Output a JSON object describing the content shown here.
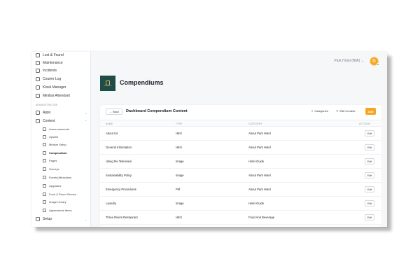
{
  "sidebar": {
    "items_top": [
      {
        "label": "Lost & Found",
        "icon": "lost-found-icon"
      },
      {
        "label": "Maintenance",
        "icon": "maintenance-icon"
      },
      {
        "label": "Incidents",
        "icon": "incidents-icon"
      },
      {
        "label": "Courier Log",
        "icon": "courier-log-icon"
      },
      {
        "label": "Kiosk Manager",
        "icon": "kiosk-icon"
      },
      {
        "label": "Minibar Attendant",
        "icon": "minibar-icon"
      }
    ],
    "section_label": "ADMINISTRATION",
    "apps": {
      "label": "Apps"
    },
    "content": {
      "label": "Content"
    },
    "content_items": [
      {
        "label": "Announcements"
      },
      {
        "label": "Upsells"
      },
      {
        "label": "Minibar Setup"
      },
      {
        "label": "Compendium"
      },
      {
        "label": "Pages"
      },
      {
        "label": "Surveys"
      },
      {
        "label": "Events/Attractions"
      },
      {
        "label": "Upgrades"
      },
      {
        "label": "Food & Room Service"
      },
      {
        "label": "Image Library"
      },
      {
        "label": "Agreements Items"
      }
    ],
    "setup": {
      "label": "Setup"
    }
  },
  "topbar": {
    "hotel_select": "Park Hotel (BMI)  ⌄",
    "avatar_initial": "G"
  },
  "header": {
    "title": "Compendiums"
  },
  "card": {
    "back_label": "← Back",
    "title": "Dashboard Compendium Content",
    "categories_label": "Categories",
    "edit_content_label": "Edit Content",
    "add_label": "Add",
    "columns": [
      "NAME",
      "TYPE",
      "CATEGORY",
      "ACTIONS"
    ],
    "edit_label": "Edit",
    "rows": [
      {
        "name": "About Us",
        "type": "Html",
        "category": "About Park Hotel"
      },
      {
        "name": "General Information",
        "type": "Html",
        "category": "About Park Hotel"
      },
      {
        "name": "Using the Television",
        "type": "Image",
        "category": "Hotel Guide"
      },
      {
        "name": "Sustainability Policy",
        "type": "Image",
        "category": "About Park Hotel"
      },
      {
        "name": "Emergency Procedures",
        "type": "Pdf",
        "category": "About Park Hotel"
      },
      {
        "name": "Laundry",
        "type": "Image",
        "category": "Hotel Guide"
      },
      {
        "name": "Three Rivers Restaurant",
        "type": "Html",
        "category": "Food And Beverage"
      }
    ]
  },
  "colors": {
    "accent": "#f5a623",
    "logo_bg": "#1e4d47",
    "online_status": "#2ecc71"
  }
}
